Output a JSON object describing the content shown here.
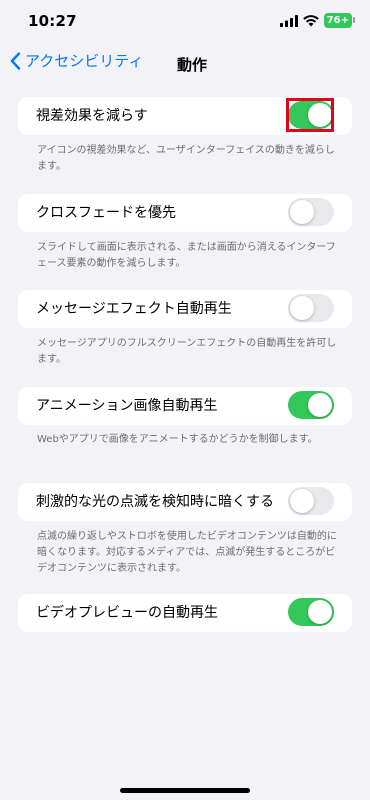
{
  "status": {
    "time": "10:27",
    "battery": "76+"
  },
  "nav": {
    "back_label": "アクセシビリティ",
    "title": "動作"
  },
  "settings": [
    {
      "label": "視差効果を減らす",
      "on": true,
      "description": "アイコンの視差効果など、ユーザインターフェイスの動きを減らします。"
    },
    {
      "label": "クロスフェードを優先",
      "on": false,
      "description": "スライドして画面に表示される、または画面から消えるインターフェース要素の動作を減らします。"
    },
    {
      "label": "メッセージエフェクト自動再生",
      "on": false,
      "description": "メッセージアプリのフルスクリーンエフェクトの自動再生を許可します。"
    },
    {
      "label": "アニメーション画像自動再生",
      "on": true,
      "description": "Webやアプリで画像をアニメートするかどうかを制御します。"
    },
    {
      "label": "刺激的な光の点滅を検知時に暗くする",
      "on": false,
      "description": "点滅の繰り返しやストロボを使用したビデオコンテンツは自動的に暗くなります。対応するメディアでは、点滅が発生するところがビデオコンテンツに表示されます。"
    },
    {
      "label": "ビデオプレビューの自動再生",
      "on": true
    }
  ],
  "colors": {
    "accent": "#007aff",
    "toggle_on": "#34c759",
    "toggle_off": "#e9e9eb",
    "highlight": "#e6001a"
  }
}
